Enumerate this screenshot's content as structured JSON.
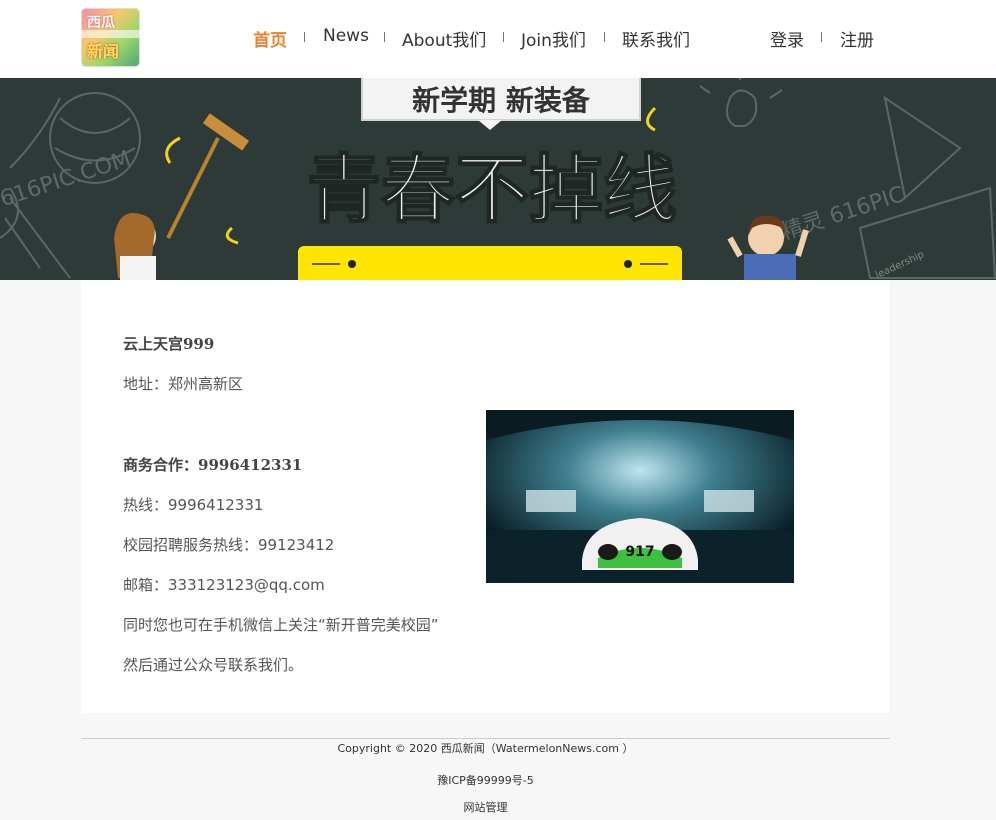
{
  "header": {
    "logo": {
      "text_top": "西瓜",
      "text_bottom": "新闻"
    },
    "nav": [
      {
        "label": "首页",
        "active": true
      },
      {
        "label": "News",
        "active": false
      },
      {
        "label": "About我们",
        "active": false
      },
      {
        "label": "Join我们",
        "active": false
      },
      {
        "label": "联系我们",
        "active": false
      }
    ],
    "auth": {
      "login": "登录",
      "register": "注册"
    }
  },
  "banner": {
    "subtitle": "新学期 新装备",
    "title": "青春不掉线",
    "watermark": "616PIC.COM",
    "watermark2": "图精灵 616PIC",
    "board_text": "leadership"
  },
  "contact": {
    "company": "云上天宫999",
    "address": "地址：郑州高新区",
    "business": "商务合作：9996412331",
    "hotline": "热线：9996412331",
    "campus": "校园招聘服务热线：99123412",
    "email": "邮箱：333123123@qq.com",
    "wechat1": "同时您也可在手机微信上关注“新开普完美校园”",
    "wechat2": "然后通过公众号联系我们。",
    "photo_label": "917"
  },
  "footer": {
    "copyright": "Copyright © 2020 西瓜新闻（WatermelonNews.com ）",
    "icp": "豫ICP备99999号-5",
    "admin": "网站管理"
  },
  "colors": {
    "accent": "#e6862f",
    "banner_bg": "#2e3a37",
    "banner_yellow": "#ffe600"
  }
}
